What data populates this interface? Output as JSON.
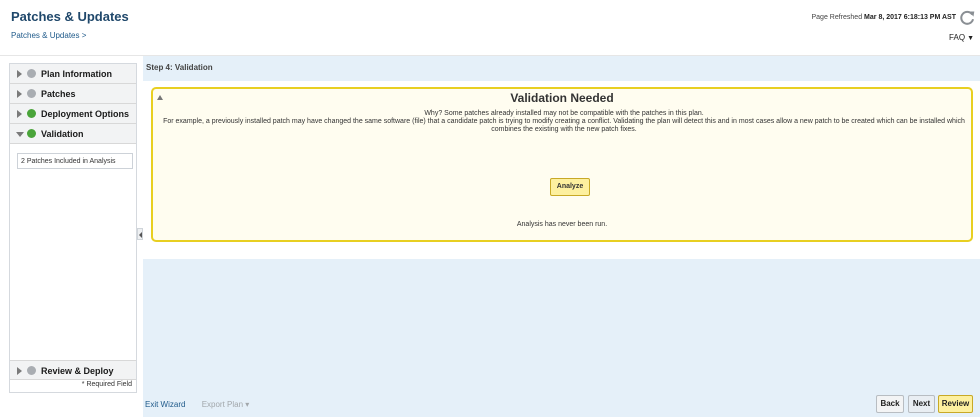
{
  "header": {
    "title": "Patches & Updates",
    "breadcrumb": "Patches & Updates >",
    "refresh_prefix": "Page Refreshed",
    "refresh_time": "Mar 8, 2017 6:18:13 PM AST",
    "faq_label": "FAQ"
  },
  "sidebar": {
    "steps": [
      {
        "label": "Plan Information",
        "status": "gray"
      },
      {
        "label": "Patches",
        "status": "gray"
      },
      {
        "label": "Deployment Options",
        "status": "green"
      },
      {
        "label": "Validation",
        "status": "green"
      }
    ],
    "sub_items": [
      "2 Patches Included in Analysis"
    ],
    "last_step": {
      "label": "Review & Deploy",
      "status": "gray"
    },
    "required_field": "* Required Field"
  },
  "main": {
    "step_title": "Step 4: Validation",
    "validation": {
      "title": "Validation Needed",
      "line1": "Why? Some patches already installed may not be compatible with the patches in this plan.",
      "line2": "For example, a previously installed patch may have changed the same software (file) that a candidate patch is trying to modify creating a conflict. Validating the plan will detect this and in most cases allow a new patch to be created which can be installed which combines the existing with the new patch fixes.",
      "analyze_label": "Analyze",
      "status": "Analysis has never been run."
    }
  },
  "footer": {
    "exit_wizard": "Exit Wizard",
    "export_plan": "Export Plan",
    "back": "Back",
    "next": "Next",
    "review": "Review"
  },
  "colors": {
    "title": "#20486b",
    "link": "#1f5a8a",
    "highlight_border": "#e8cf21",
    "highlight_button": "#fdf09f",
    "status_green": "#4aa43a",
    "status_gray": "#a9adb2"
  },
  "icons": [
    "refresh-icon",
    "chevron-down-icon",
    "expand-arrow-icon",
    "status-dot-icon",
    "collapse-arrow-icon"
  ]
}
